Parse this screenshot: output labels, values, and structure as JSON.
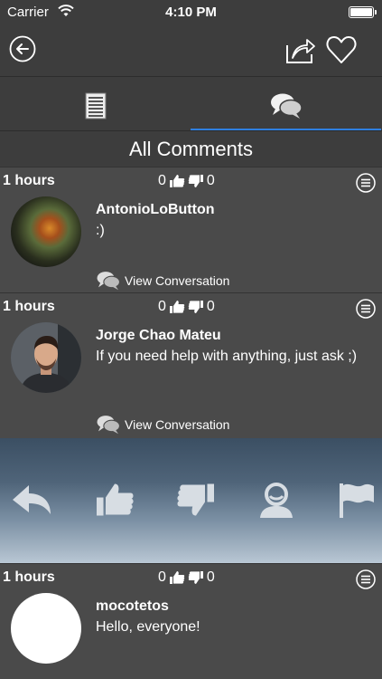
{
  "status_bar": {
    "carrier": "Carrier",
    "time": "4:10 PM"
  },
  "header": {
    "title": "All Comments"
  },
  "colors": {
    "tab_indicator": "#2f7fe0",
    "background": "#4a4a4a",
    "bar": "#3d3d3d"
  },
  "comments": [
    {
      "age": "1 hours",
      "likes": "0",
      "dislikes": "0",
      "user": "AntonioLoButton",
      "text": ":)",
      "conversation": "View Conversation"
    },
    {
      "age": "1 hours",
      "likes": "0",
      "dislikes": "0",
      "user": "Jorge Chao Mateu",
      "text": "If you need help with anything, just ask ;)",
      "conversation": "View Conversation"
    },
    {
      "age": "1 hours",
      "likes": "0",
      "dislikes": "0",
      "user": "mocotetos",
      "text": "Hello, everyone!"
    }
  ],
  "actions": [
    "reply-icon",
    "thumbs-up-icon",
    "thumbs-down-icon",
    "profile-icon",
    "flag-icon"
  ]
}
